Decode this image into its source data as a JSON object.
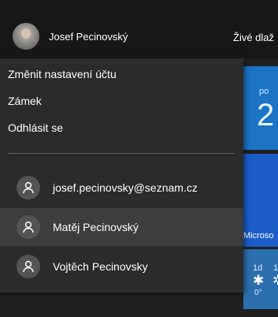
{
  "header": {
    "user_name": "Josef Pecinovský",
    "tiles_title": "Živé dlaž"
  },
  "menu": {
    "items": [
      {
        "label": "Změnit nastavení účtu"
      },
      {
        "label": "Zámek"
      },
      {
        "label": "Odhlásit se"
      }
    ],
    "accounts": [
      {
        "label": "josef.pecinovsky@seznam.cz"
      },
      {
        "label": "Matěj Pecinovský"
      },
      {
        "label": "Vojtěch Pecinovsky"
      }
    ]
  },
  "tiles": {
    "calendar_day": "po",
    "calendar_date": "2",
    "microsoft_label": "Microso",
    "weather_day1": "1d",
    "weather_day2": "1",
    "weather_temp": "0°"
  },
  "colors": {
    "menu_background": "#2b2b2b",
    "selected_row": "#3d3d3d",
    "tile_blue": "#1c74c5"
  },
  "icons": {
    "user_photo": "user-photo",
    "account_avatar": "person-avatar-icon",
    "weather": "snowflake-icon"
  }
}
